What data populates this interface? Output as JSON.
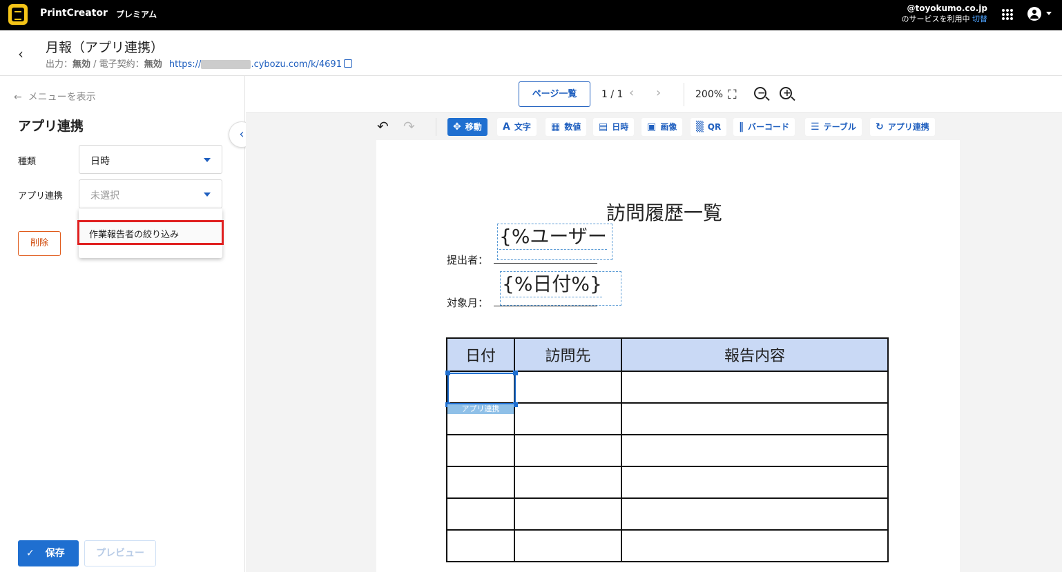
{
  "topbar": {
    "app_name": "PrintCreator",
    "plan": "プレミアム",
    "account_domain": "@toyokumo.co.jp",
    "account_status": "のサービスを利用中",
    "switch_label": "切替"
  },
  "header": {
    "title": "月報（アプリ連携）",
    "output_label": "出力：",
    "output_value": "無効",
    "esign_label": " / 電子契約：",
    "esign_value": "無効",
    "url_prefix": "https://",
    "url_suffix": ".cybozu.com/k/4691"
  },
  "sidebar": {
    "menu_toggle": "メニューを表示",
    "section_title": "アプリ連携",
    "type_label": "種類",
    "type_value": "日時",
    "link_label": "アプリ連携",
    "link_placeholder": "未選択",
    "dropdown_options": [
      "作業報告者の絞り込み"
    ],
    "delete_label": "削除",
    "save_label": "保存",
    "preview_label": "プレビュー"
  },
  "pagebar": {
    "page_list_label": "ページ一覧",
    "page_number": "1 / 1",
    "zoom": "200%"
  },
  "toolbar": {
    "tools": [
      {
        "label": "移動",
        "icon": "move-icon"
      },
      {
        "label": "文字",
        "icon": "text-icon"
      },
      {
        "label": "数値",
        "icon": "calculator-icon"
      },
      {
        "label": "日時",
        "icon": "calendar-icon"
      },
      {
        "label": "画像",
        "icon": "image-icon"
      },
      {
        "label": "QR",
        "icon": "qr-icon"
      },
      {
        "label": "バーコード",
        "icon": "barcode-icon"
      },
      {
        "label": "テーブル",
        "icon": "list-icon"
      },
      {
        "label": "アプリ連携",
        "icon": "sync-icon"
      }
    ]
  },
  "document": {
    "title": "訪問履歴一覧",
    "submitter_label": "提出者：",
    "submitter_var": "{%ユーザー",
    "month_label": "対象月：",
    "month_var": "{%日付%}",
    "table_headers": [
      "日付",
      "訪問先",
      "報告内容"
    ],
    "selection_tag": "アプリ連携"
  },
  "colors": {
    "accent": "#1f6fd0",
    "danger": "#e02020",
    "table_header": "#c9d9f5"
  }
}
